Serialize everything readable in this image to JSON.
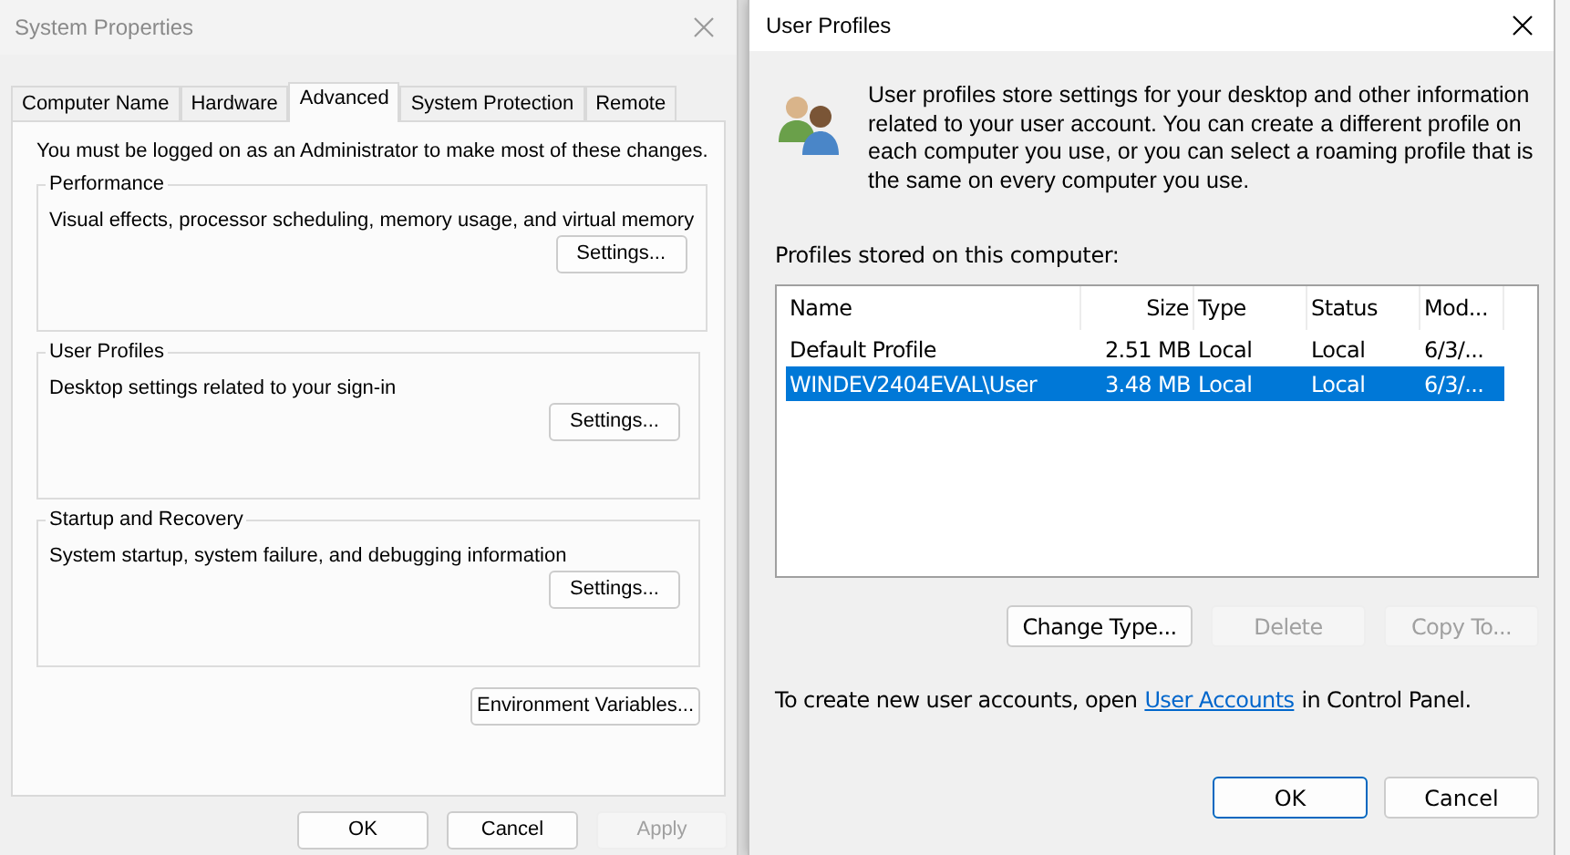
{
  "system_properties": {
    "title": "System Properties",
    "tabs": [
      {
        "label": "Computer Name",
        "selected": false
      },
      {
        "label": "Hardware",
        "selected": false
      },
      {
        "label": "Advanced",
        "selected": true
      },
      {
        "label": "System Protection",
        "selected": false
      },
      {
        "label": "Remote",
        "selected": false
      }
    ],
    "notice": "You must be logged on as an Administrator to make most of these changes.",
    "groups": [
      {
        "title": "Performance",
        "description": "Visual effects, processor scheduling, memory usage, and virtual memory",
        "button": "Settings..."
      },
      {
        "title": "User Profiles",
        "description": "Desktop settings related to your sign-in",
        "button": "Settings..."
      },
      {
        "title": "Startup and Recovery",
        "description": "System startup, system failure, and debugging information",
        "button": "Settings..."
      }
    ],
    "environment_button": "Environment Variables...",
    "buttons": [
      {
        "label": "OK",
        "disabled": false
      },
      {
        "label": "Cancel",
        "disabled": false
      },
      {
        "label": "Apply",
        "disabled": true
      }
    ]
  },
  "user_profiles": {
    "title": "User Profiles",
    "description": "User profiles store settings for your desktop and other information related to your user account. You can create a different profile on each computer you use, or you can select a roaming profile that is the same on every computer you use.",
    "list_label": "Profiles stored on this computer:",
    "columns": [
      "Name",
      "Size",
      "Type",
      "Status",
      "Mod..."
    ],
    "rows": [
      {
        "cells": [
          "Default Profile",
          "2.51 MB",
          "Local",
          "Local",
          "6/3/..."
        ],
        "selected": false
      },
      {
        "cells": [
          "WINDEV2404EVAL\\User",
          "3.48 MB",
          "Local",
          "Local",
          "6/3/..."
        ],
        "selected": true
      }
    ],
    "actions": [
      {
        "label": "Change Type...",
        "disabled": false
      },
      {
        "label": "Delete",
        "disabled": true
      },
      {
        "label": "Copy To...",
        "disabled": true
      }
    ],
    "footer_before": "To create new user accounts, open",
    "footer_link": "User Accounts",
    "footer_after": "in Control Panel.",
    "buttons": [
      {
        "label": "OK",
        "default": true
      },
      {
        "label": "Cancel",
        "default": false
      }
    ]
  }
}
